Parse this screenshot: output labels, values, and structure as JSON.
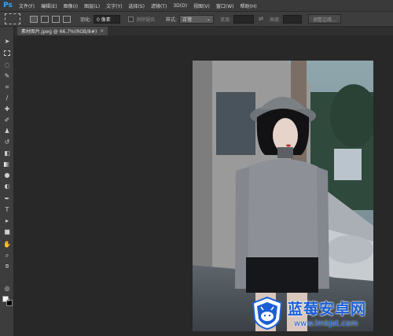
{
  "app": {
    "logo": "Ps"
  },
  "menu": [
    "文件(F)",
    "编辑(E)",
    "图像(I)",
    "图层(L)",
    "文字(Y)",
    "选择(S)",
    "滤镜(T)",
    "3D(D)",
    "视图(V)",
    "窗口(W)",
    "帮助(H)"
  ],
  "options": {
    "feather_label": "羽化:",
    "feather_value": "0 像素",
    "antialias_label": "消除锯齿",
    "style_label": "样式:",
    "style_value": "正常",
    "width_label": "宽度:",
    "height_label": "高度:",
    "refine_edge": "调整边缘..."
  },
  "document_tab": {
    "title": "素材图片.jpeg @ 66.7%(RGB/8#)",
    "close": "×"
  },
  "watermark": {
    "title": "蓝莓安卓网",
    "url": "www.lmkjst.com"
  },
  "colors": {
    "foreground": "#ffffff",
    "background": "#000000",
    "accent": "#31a8ff",
    "watermark": "#1a5fd6"
  },
  "toolbar_icons": [
    "move-icon",
    "marquee-icon",
    "lasso-icon",
    "quick-select-icon",
    "crop-icon",
    "eyedropper-icon",
    "healing-brush-icon",
    "brush-icon",
    "clone-stamp-icon",
    "history-brush-icon",
    "eraser-icon",
    "gradient-icon",
    "blur-icon",
    "dodge-icon",
    "pen-icon",
    "type-icon",
    "path-select-icon",
    "shape-icon",
    "hand-icon",
    "zoom-icon"
  ]
}
